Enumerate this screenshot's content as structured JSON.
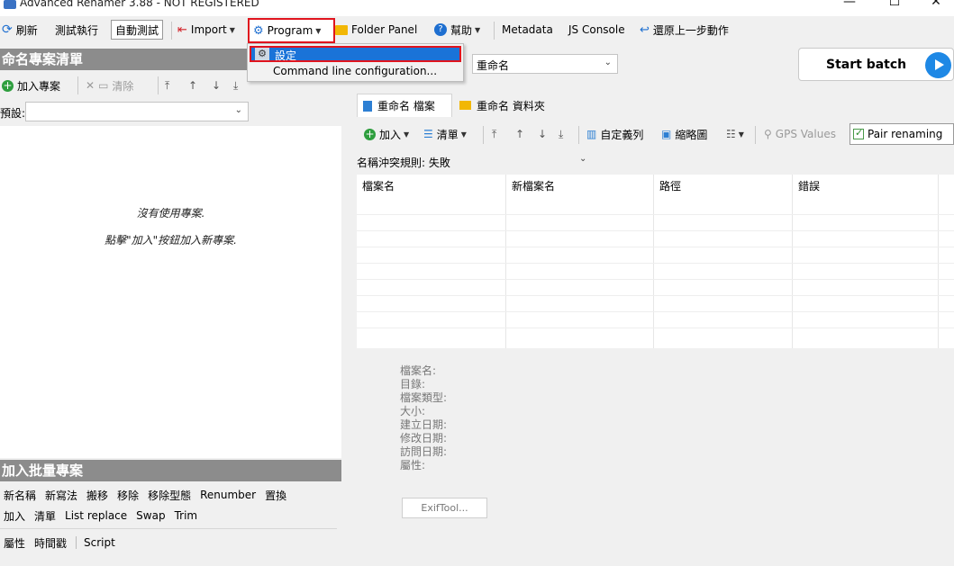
{
  "window": {
    "title": "Advanced Renamer 3.88 - NOT REGISTERED",
    "minimize": "—",
    "maximize": "☐",
    "close": "✕"
  },
  "toolbar": {
    "refresh": "刷新",
    "test_run": "測試執行",
    "auto_test": "自動測試",
    "import": "Import",
    "program": "Program",
    "folder_panel": "Folder Panel",
    "help": "幫助",
    "metadata": "Metadata",
    "js_console": "JS Console",
    "undo": "還原上一步動作"
  },
  "program_menu": {
    "items": [
      "設定",
      "Command line configuration..."
    ]
  },
  "left_panel": {
    "header": "命名專案清單",
    "add_project": "加入專案",
    "clear": "清除",
    "preset_label": "預設:",
    "empty_line1": "沒有使用專案.",
    "empty_line2": "點擊\"加入\"按鈕加入新專案."
  },
  "batch_panel": {
    "header": "加入批量專案",
    "row1": [
      "新名稱",
      "新寫法",
      "搬移",
      "移除",
      "移除型態",
      "Renumber",
      "置換"
    ],
    "row2": [
      "加入",
      "清單",
      "List replace",
      "Swap",
      "Trim"
    ],
    "row3": [
      "屬性",
      "時間戳",
      "Script"
    ]
  },
  "mode": {
    "selected": "重命名"
  },
  "start_batch": {
    "label": "Start batch"
  },
  "tabs": [
    "重命名 檔案",
    "重命名 資料夾"
  ],
  "files_toolbar": {
    "add": "加入",
    "list": "清單",
    "custom_columns": "自定義列",
    "thumbnails": "縮略圖",
    "gps_values": "GPS Values",
    "pair_renaming": "Pair renaming"
  },
  "conflict": {
    "value": "名稱沖突規則: 失敗"
  },
  "table": {
    "columns": [
      "檔案名",
      "新檔案名",
      "路徑",
      "錯誤"
    ]
  },
  "file_info": {
    "lines": [
      "檔案名:",
      "目錄:",
      "檔案類型:",
      "大小:",
      "建立日期:",
      "修改日期:",
      "訪問日期:",
      "屬性:"
    ],
    "exiftool": "ExifTool..."
  },
  "colors": {
    "accent": "#1a73d8",
    "highlight_box": "#e0141e",
    "panel_header": "#8c8c8c"
  }
}
